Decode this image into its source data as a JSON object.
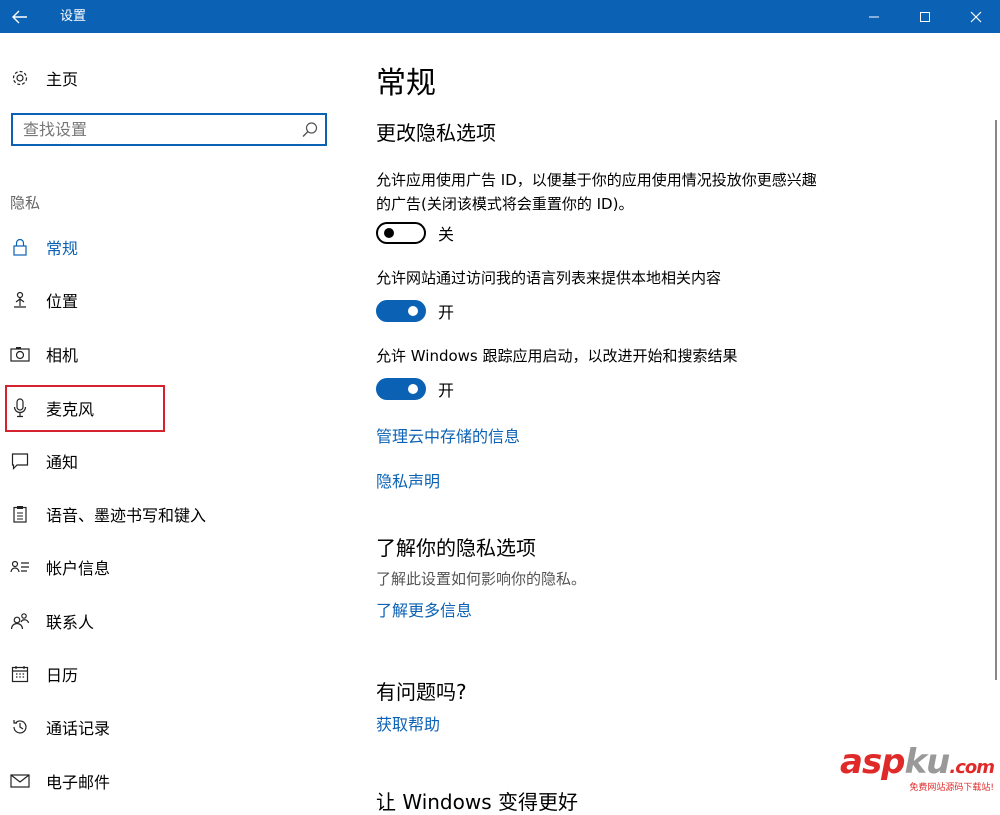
{
  "window": {
    "title": "设置"
  },
  "sidebar": {
    "home_label": "主页",
    "search_placeholder": "查找设置",
    "section_header": "隐私",
    "items": [
      {
        "label": "常规",
        "icon": "lock-icon",
        "active": true
      },
      {
        "label": "位置",
        "icon": "location-person-icon"
      },
      {
        "label": "相机",
        "icon": "camera-icon"
      },
      {
        "label": "麦克风",
        "icon": "microphone-icon",
        "highlighted": true
      },
      {
        "label": "通知",
        "icon": "notification-icon"
      },
      {
        "label": "语音、墨迹书写和键入",
        "icon": "clipboard-icon"
      },
      {
        "label": "帐户信息",
        "icon": "account-info-icon"
      },
      {
        "label": "联系人",
        "icon": "contacts-icon"
      },
      {
        "label": "日历",
        "icon": "calendar-icon"
      },
      {
        "label": "通话记录",
        "icon": "call-history-icon"
      },
      {
        "label": "电子邮件",
        "icon": "email-icon"
      }
    ]
  },
  "main": {
    "title": "常规",
    "section1": {
      "heading": "更改隐私选项",
      "settings": [
        {
          "description_line1": "允许应用使用广告 ID，以便基于你的应用使用情况投放你更感兴趣",
          "description_line2": "的广告(关闭该模式将会重置你的 ID)。",
          "state": "关"
        },
        {
          "description_line1": "允许网站通过访问我的语言列表来提供本地相关内容",
          "state": "开"
        },
        {
          "description_line1": "允许 Windows 跟踪应用启动，以改进开始和搜索结果",
          "state": "开"
        }
      ],
      "link_cloud": "管理云中存储的信息",
      "link_privacy": "隐私声明"
    },
    "section2": {
      "heading": "了解你的隐私选项",
      "text": "了解此设置如何影响你的隐私。",
      "link": "了解更多信息"
    },
    "section3": {
      "heading": "有问题吗?",
      "link": "获取帮助"
    },
    "section4_partial": "让 Windows 变得更好"
  },
  "watermark": {
    "main_a": "asp",
    "main_b": "ku",
    "suffix": ".com",
    "sub": "免费网站源码下载站!"
  },
  "colors": {
    "accent": "#0b62b5",
    "highlight_border": "#d4232f"
  }
}
